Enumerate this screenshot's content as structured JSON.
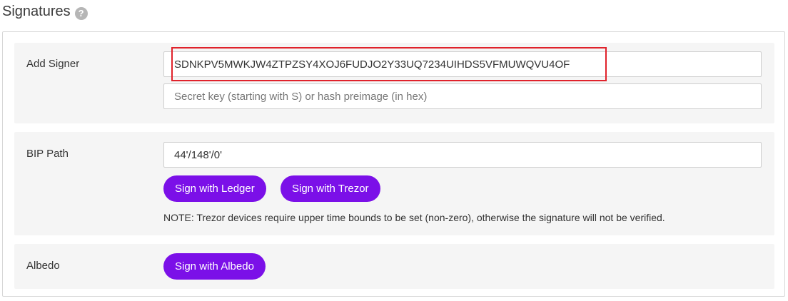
{
  "section": {
    "title": "Signatures",
    "help_icon": "help-icon"
  },
  "add_signer": {
    "label": "Add Signer",
    "signer_value": "SDNKPV5MWKJW4ZTPZSY4XOJ6FUDJO2Y33UQ7234UIHDS5VFMUWQVU4OF",
    "placeholder": "Secret key (starting with S) or hash preimage (in hex)"
  },
  "bip_path": {
    "label": "BIP Path",
    "value": "44'/148'/0'",
    "ledger_button": "Sign with Ledger",
    "trezor_button": "Sign with Trezor",
    "note": "NOTE: Trezor devices require upper time bounds to be set (non-zero), otherwise the signature will not be verified."
  },
  "albedo": {
    "label": "Albedo",
    "button": "Sign with Albedo"
  },
  "colors": {
    "accent": "#7b10e8",
    "highlight": "#e0222b",
    "row_background": "#f5f5f5"
  }
}
